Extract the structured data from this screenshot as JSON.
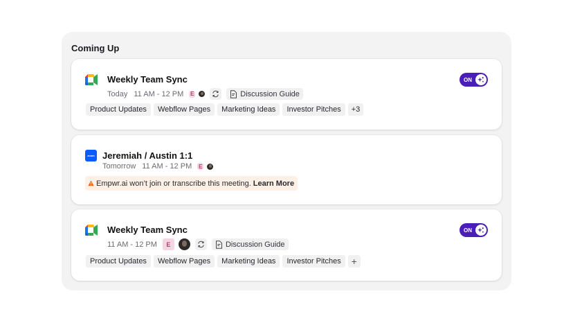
{
  "section_title": "Coming Up",
  "meetings": [
    {
      "platform": "google-meet",
      "title": "Weekly Team Sync",
      "day": "Today",
      "time": "11 AM - 12 PM",
      "attendee_initial": "E",
      "guide_label": "Discussion Guide",
      "tags": [
        "Product Updates",
        "Webflow Pages",
        "Marketing Ideas",
        "Investor Pitches"
      ],
      "more_tags": "+3",
      "toggle_label": "ON"
    },
    {
      "platform": "zoom",
      "zoom_logo_text": "zoom",
      "title": "Jeremiah / Austin 1:1",
      "day": "Tomorrow",
      "time": "11 AM - 12 PM",
      "attendee_initial": "E",
      "warning_text": "Empwr.ai won’t join or transcribe this meeting.",
      "warning_link": "Learn More"
    },
    {
      "platform": "google-meet",
      "title": "Weekly Team Sync",
      "time": "11 AM - 12 PM",
      "attendee_initial": "E",
      "guide_label": "Discussion Guide",
      "tags": [
        "Product Updates",
        "Webflow Pages",
        "Marketing Ideas",
        "Investor Pitches"
      ],
      "add_tag_label": "+",
      "toggle_label": "ON"
    }
  ],
  "colors": {
    "toggle_on": "#4a1fb8",
    "zoom_blue": "#0b5cff",
    "warning_bg": "#fdf0e6",
    "badge_pink": "#f6d5e3"
  }
}
